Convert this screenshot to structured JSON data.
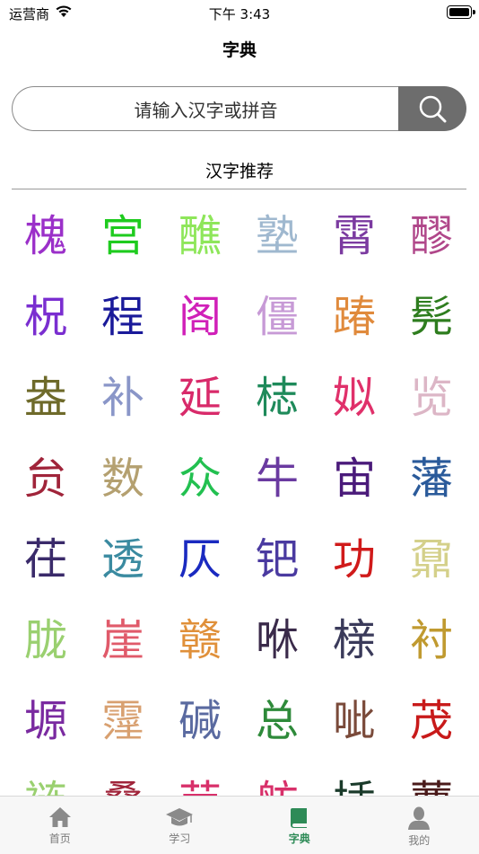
{
  "status_bar": {
    "carrier": "运营商",
    "time": "下午 3:43"
  },
  "nav": {
    "title": "字典"
  },
  "search": {
    "placeholder": "请输入汉字或拼音"
  },
  "section": {
    "title": "汉字推荐"
  },
  "characters": [
    {
      "char": "槐",
      "color": "#9b30c9"
    },
    {
      "char": "宫",
      "color": "#1ecb1e"
    },
    {
      "char": "醮",
      "color": "#8ee65a"
    },
    {
      "char": "塾",
      "color": "#9fb8cf"
    },
    {
      "char": "霄",
      "color": "#7b3aa0"
    },
    {
      "char": "醪",
      "color": "#b0478a"
    },
    {
      "char": "柷",
      "color": "#7a2ed0"
    },
    {
      "char": "程",
      "color": "#1a1a9a"
    },
    {
      "char": "阁",
      "color": "#d020b8"
    },
    {
      "char": "僵",
      "color": "#c79ad6"
    },
    {
      "char": "踳",
      "color": "#e08a3c"
    },
    {
      "char": "髡",
      "color": "#2e7d1e"
    },
    {
      "char": "盎",
      "color": "#6e6a2a"
    },
    {
      "char": "补",
      "color": "#8a96c8"
    },
    {
      "char": "延",
      "color": "#d82a6a"
    },
    {
      "char": "梽",
      "color": "#1e8a5a"
    },
    {
      "char": "姒",
      "color": "#e0306a"
    },
    {
      "char": "览",
      "color": "#dcb6c6"
    },
    {
      "char": "贠",
      "color": "#a0243a"
    },
    {
      "char": "数",
      "color": "#b4a070"
    },
    {
      "char": "众",
      "color": "#22c050"
    },
    {
      "char": "牛",
      "color": "#6a3aa0"
    },
    {
      "char": "宙",
      "color": "#4a1a7a"
    },
    {
      "char": "藩",
      "color": "#2a5a9a"
    },
    {
      "char": "茌",
      "color": "#3a2a6a"
    },
    {
      "char": "透",
      "color": "#3a8aa0"
    },
    {
      "char": "仄",
      "color": "#1a2ac0"
    },
    {
      "char": "钯",
      "color": "#4a3aa0"
    },
    {
      "char": "功",
      "color": "#d01a1a"
    },
    {
      "char": "鼐",
      "color": "#d4d08a"
    },
    {
      "char": "胧",
      "color": "#9ad070"
    },
    {
      "char": "崖",
      "color": "#e05a6a"
    },
    {
      "char": "赣",
      "color": "#e0903a"
    },
    {
      "char": "咻",
      "color": "#3a2a4a"
    },
    {
      "char": "榇",
      "color": "#3a3a5a"
    },
    {
      "char": "衬",
      "color": "#c09a30"
    },
    {
      "char": "塬",
      "color": "#7a2aa0"
    },
    {
      "char": "霪",
      "color": "#d8a070"
    },
    {
      "char": "碱",
      "color": "#5a6aa0"
    },
    {
      "char": "总",
      "color": "#2e8a3a"
    },
    {
      "char": "呲",
      "color": "#7a4a3a"
    },
    {
      "char": "茂",
      "color": "#c81a1a"
    },
    {
      "char": "裢",
      "color": "#9ad070"
    },
    {
      "char": "叠",
      "color": "#a0243a"
    },
    {
      "char": "莁",
      "color": "#d8306a"
    },
    {
      "char": "舫",
      "color": "#d8306a"
    },
    {
      "char": "插",
      "color": "#1a3a2a"
    },
    {
      "char": "蕈",
      "color": "#4a1a1a"
    }
  ],
  "tabs": [
    {
      "label": "首页",
      "icon": "home-icon"
    },
    {
      "label": "学习",
      "icon": "graduation-cap-icon"
    },
    {
      "label": "字典",
      "icon": "book-icon",
      "active": true
    },
    {
      "label": "我的",
      "icon": "person-icon"
    }
  ],
  "colors": {
    "accent": "#2e8b57",
    "search_button": "#6d6d6d",
    "tab_inactive": "#7a7a7a"
  }
}
